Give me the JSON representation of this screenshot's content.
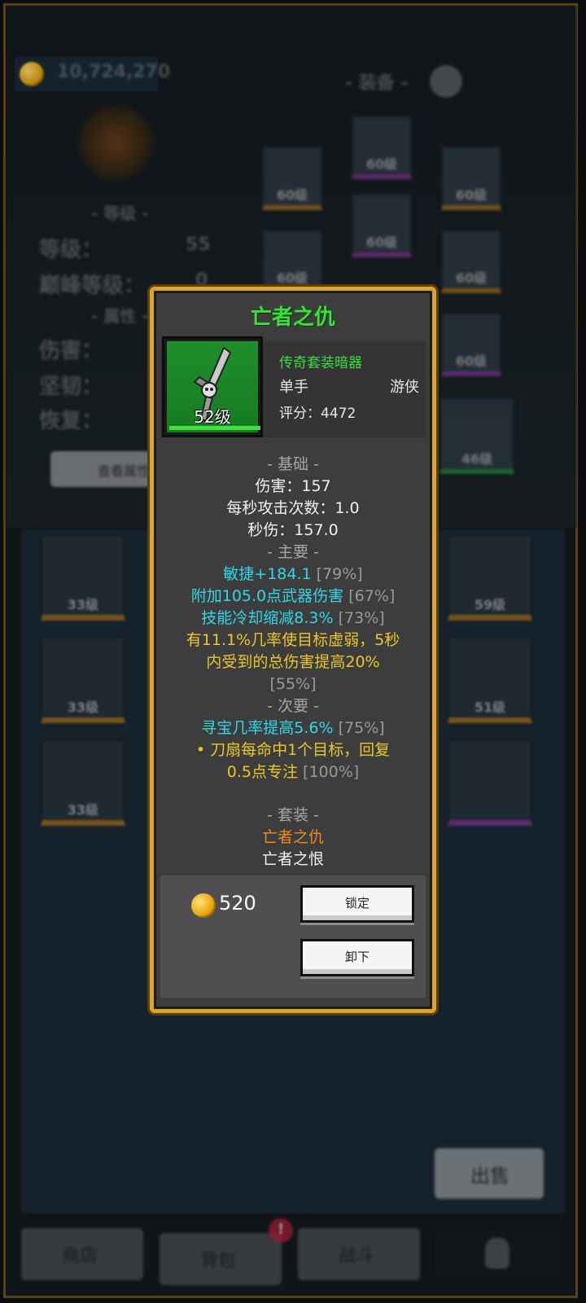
{
  "background": {
    "gold_amount": "10,724,270",
    "equip_header": "- 装备 -",
    "level_header": "- 等级 -",
    "level_label": "等级：",
    "level_value": "55",
    "peak_label": "巅峰等级：",
    "peak_value": "0",
    "attr_header": "- 属性 -",
    "damage_label": "伤害：",
    "toughness_label": "坚韧：",
    "recovery_label": "恢复：",
    "view_button": "查看属性",
    "sell_button": "出售",
    "slot_levels": [
      "60级",
      "60级",
      "60级",
      "60级",
      "60级",
      "60级",
      "60级",
      "46级",
      "33级",
      "33级",
      "33级",
      "59级",
      "51级"
    ],
    "tabs": [
      "商店",
      "背包",
      "战斗",
      ""
    ],
    "badge": "!"
  },
  "dialog": {
    "title": "亡者之仇",
    "item_level": "52级",
    "item_type": "传奇套装暗器",
    "hand": "单手",
    "class": "游侠",
    "score_label": "评分：",
    "score_value": "4472",
    "basic_header": "- 基础 -",
    "damage": "伤害：157",
    "attack_speed": "每秒攻击次数：1.0",
    "dps": "秒伤：157.0",
    "main_header": "- 主要 -",
    "main_stats": [
      {
        "text": "敏捷+184.1",
        "pct": "[79%]"
      },
      {
        "text": "附加105.0点武器伤害",
        "pct": "[67%]"
      },
      {
        "text": "技能冷却缩减8.3%",
        "pct": "[73%]"
      }
    ],
    "main_special_1": "有11.1%几率使目标虚弱，5秒",
    "main_special_2": "内受到的总伤害提高20%",
    "main_special_pct": "[55%]",
    "secondary_header": "- 次要 -",
    "secondary_stat": {
      "text": "寻宝几率提高5.6%",
      "pct": "[75%]"
    },
    "secondary_special_1": "• 刀扇每命中1个目标，回复",
    "secondary_special_2": "0.5点专注",
    "secondary_special_pct": "[100%]",
    "set_header": "- 套装 -",
    "set_active": "亡者之仇",
    "set_inactive": "亡者之恨",
    "price": "520",
    "lock_button": "锁定",
    "unequip_button": "卸下"
  }
}
